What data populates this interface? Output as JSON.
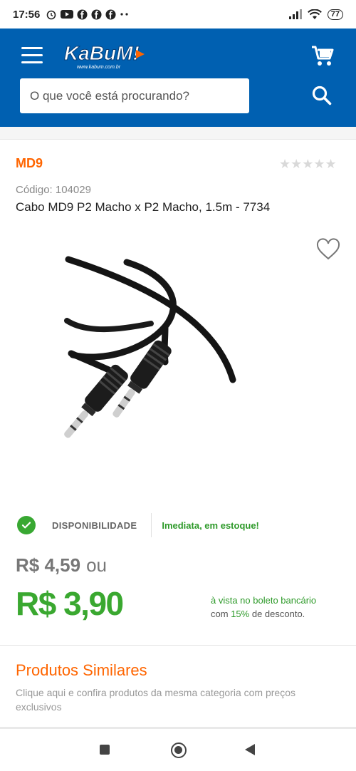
{
  "status_bar": {
    "time": "17:56",
    "battery": "77"
  },
  "header": {
    "logo_text": "KaBuM!",
    "logo_sub": "www.kabum.com.br",
    "search_placeholder": "O que você está procurando?",
    "brand_color": "#0060b1",
    "icons": [
      "menu-icon",
      "cart-icon",
      "search-icon"
    ]
  },
  "product": {
    "brand": "MD9",
    "code_label": "Código: 104029",
    "title": "Cabo MD9 P2 Macho x P2 Macho, 1.5m - 7734",
    "rating_stars": "★★★★★",
    "rating_value": 0,
    "favorite_icon": "heart-outline-icon"
  },
  "availability": {
    "label": "DISPONIBILIDADE",
    "value": "Imediata, em estoque!"
  },
  "prices": {
    "old_price": "R$ 4,59",
    "old_suffix": "ou",
    "new_price": "R$ 3,90",
    "boleto_line1": "à vista no boleto bancário",
    "boleto_line2_prefix": "com",
    "boleto_discount": "15%",
    "boleto_line2_suffix": "de desconto."
  },
  "similares": {
    "title": "Produtos Similares",
    "description": "Clique aqui e confira produtos da mesma categoria com preços exclusivos"
  },
  "colors": {
    "accent_orange": "#ff6500",
    "price_green": "#3aa830"
  }
}
